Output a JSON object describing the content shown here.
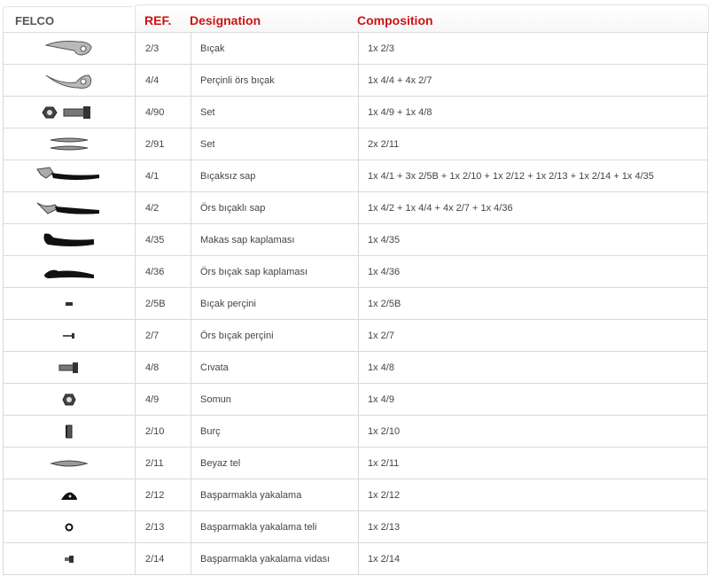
{
  "brand": "FELCO",
  "columns": {
    "ref": "REF.",
    "designation": "Designation",
    "composition": "Composition"
  },
  "colors": {
    "header_text": "#cc1212",
    "part_fill": "#333333"
  },
  "rows": [
    {
      "icon": "blade-icon",
      "ref": "2/3",
      "designation": "Bıçak",
      "composition": "1x 2/3"
    },
    {
      "icon": "anvil-blade-icon",
      "ref": "4/4",
      "designation": "Perçinli örs bıçak",
      "composition": "1x 4/4 + 4x 2/7"
    },
    {
      "icon": "bolt-nut-set-icon",
      "ref": "4/90",
      "designation": "Set",
      "composition": "1x 4/9 + 1x 4/8"
    },
    {
      "icon": "wire-set-icon",
      "ref": "2/91",
      "designation": "Set",
      "composition": "2x 2/11"
    },
    {
      "icon": "handle-without-blade-icon",
      "ref": "4/1",
      "designation": "Bıçaksız sap",
      "composition": "1x 4/1 + 3x 2/5B + 1x 2/10 + 1x 2/12 + 1x 2/13 + 1x 2/14 + 1x 4/35"
    },
    {
      "icon": "handle-with-anvil-icon",
      "ref": "4/2",
      "designation": "Örs bıçaklı sap",
      "composition": "1x 4/2 + 1x 4/4 + 4x 2/7 + 1x 4/36"
    },
    {
      "icon": "handle-cover-icon",
      "ref": "4/35",
      "designation": "Makas sap kaplaması",
      "composition": "1x 4/35"
    },
    {
      "icon": "anvil-handle-cover-icon",
      "ref": "4/36",
      "designation": "Örs bıçak sap kaplaması",
      "composition": "1x 4/36"
    },
    {
      "icon": "blade-rivet-icon",
      "ref": "2/5B",
      "designation": "Bıçak perçini",
      "composition": "1x 2/5B"
    },
    {
      "icon": "anvil-rivet-icon",
      "ref": "2/7",
      "designation": "Örs bıçak perçini",
      "composition": "1x 2/7"
    },
    {
      "icon": "bolt-icon",
      "ref": "4/8",
      "designation": "Cıvata",
      "composition": "1x 4/8"
    },
    {
      "icon": "nut-icon",
      "ref": "4/9",
      "designation": "Somun",
      "composition": "1x 4/9"
    },
    {
      "icon": "bushing-icon",
      "ref": "2/10",
      "designation": "Burç",
      "composition": "1x 2/10"
    },
    {
      "icon": "spring-wire-icon",
      "ref": "2/11",
      "designation": "Beyaz tel",
      "composition": "1x 2/11"
    },
    {
      "icon": "thumb-catch-icon",
      "ref": "2/12",
      "designation": "Başparmakla yakalama",
      "composition": "1x 2/12"
    },
    {
      "icon": "catch-wire-icon",
      "ref": "2/13",
      "designation": "Başparmakla yakalama teli",
      "composition": "1x 2/13"
    },
    {
      "icon": "catch-screw-icon",
      "ref": "2/14",
      "designation": "Başparmakla yakalama vidası",
      "composition": "1x 2/14"
    }
  ]
}
